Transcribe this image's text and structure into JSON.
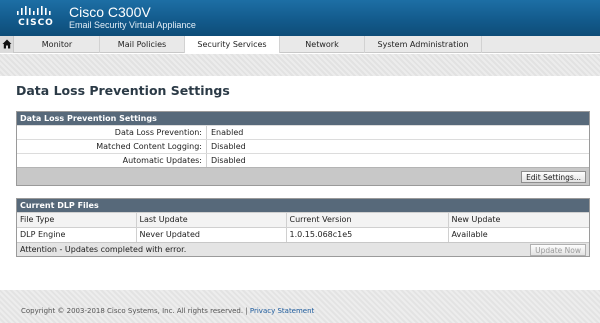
{
  "header": {
    "logo_text": "CISCO",
    "product_name": "Cisco C300V",
    "product_subtitle": "Email Security Virtual Appliance"
  },
  "nav": {
    "home_icon": "home-icon",
    "tabs": [
      {
        "label": "Monitor"
      },
      {
        "label": "Mail Policies"
      },
      {
        "label": "Security Services",
        "active": true
      },
      {
        "label": "Network"
      },
      {
        "label": "System Administration"
      }
    ]
  },
  "page": {
    "title": "Data Loss Prevention Settings"
  },
  "settings_panel": {
    "title": "Data Loss Prevention Settings",
    "rows": [
      {
        "label": "Data Loss Prevention:",
        "value": "Enabled"
      },
      {
        "label": "Matched Content Logging:",
        "value": "Disabled"
      },
      {
        "label": "Automatic Updates:",
        "value": "Disabled"
      }
    ],
    "edit_button": "Edit Settings..."
  },
  "dlp_files_panel": {
    "title": "Current DLP Files",
    "columns": [
      "File Type",
      "Last Update",
      "Current Version",
      "New Update"
    ],
    "rows": [
      [
        "DLP Engine",
        "Never Updated",
        "1.0.15.068c1e5",
        "Available"
      ]
    ],
    "attention": "Attention - Updates completed with error.",
    "update_button": "Update Now"
  },
  "footer": {
    "copyright": "Copyright © 2003-2018 Cisco Systems, Inc. All rights reserved. |",
    "privacy_link": "Privacy Statement"
  },
  "colors": {
    "header_blue": "#12598a",
    "panel_head": "#57697a",
    "link_blue": "#1c5a9c"
  }
}
